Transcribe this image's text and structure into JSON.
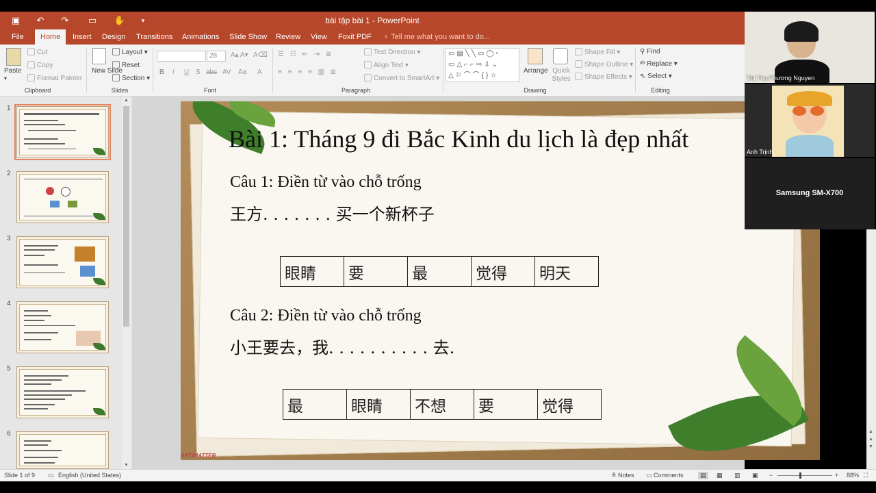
{
  "window": {
    "title": "bài tập bài 1 - PowerPoint"
  },
  "quick_access": {
    "save_icon": "save-icon",
    "undo_icon": "undo-icon",
    "redo_icon": "redo-icon",
    "present_icon": "present-icon",
    "touch_icon": "touch-mode-icon",
    "customize_icon": "customize-icon"
  },
  "tabs": [
    {
      "label": "File"
    },
    {
      "label": "Home"
    },
    {
      "label": "Insert"
    },
    {
      "label": "Design"
    },
    {
      "label": "Transitions"
    },
    {
      "label": "Animations"
    },
    {
      "label": "Slide Show"
    },
    {
      "label": "Review"
    },
    {
      "label": "View"
    },
    {
      "label": "Foxit PDF"
    },
    {
      "label": "Tell me what you want to do..."
    }
  ],
  "ribbon": {
    "clipboard": {
      "paste": "Paste",
      "cut": "Cut",
      "copy": "Copy",
      "format_painter": "Format Painter",
      "label": "Clipboard"
    },
    "slides": {
      "new_slide": "New Slide",
      "layout": "Layout",
      "reset": "Reset",
      "section": "Section",
      "label": "Slides"
    },
    "font": {
      "font_size": "28",
      "label": "Font",
      "buttons": [
        "B",
        "I",
        "U",
        "S",
        "abc",
        "AV",
        "Aa",
        "A"
      ]
    },
    "paragraph": {
      "text_direction": "Text Direction",
      "align_text": "Align Text",
      "convert_smartart": "Convert to SmartArt",
      "label": "Paragraph"
    },
    "drawing": {
      "arrange": "Arrange",
      "quick_styles": "Quick Styles",
      "shape_fill": "Shape Fill",
      "shape_outline": "Shape Outline",
      "shape_effects": "Shape Effects",
      "label": "Drawing"
    },
    "editing": {
      "find": "Find",
      "replace": "Replace",
      "select": "Select",
      "label": "Editing"
    }
  },
  "thumbnails": [
    {
      "num": "1"
    },
    {
      "num": "2"
    },
    {
      "num": "3"
    },
    {
      "num": "4"
    },
    {
      "num": "5"
    },
    {
      "num": "6"
    }
  ],
  "slide": {
    "title": "Bài 1: Tháng 9 đi Bắc Kinh du lịch là đẹp nhất",
    "q1_label": "Câu 1: Điền từ vào chỗ trống",
    "q1_sentence": "王方. . . . . . .   买一个新杯子",
    "q1_words": [
      "眼睛",
      "要",
      "最",
      "觉得",
      "明天"
    ],
    "q2_label": "Câu 2: Điền từ vào chỗ trống",
    "q2_sentence": "小王要去，我. . . . . . . . . .   去.",
    "q2_words": [
      "最",
      "眼睛",
      "不想",
      "要",
      "觉得"
    ],
    "brand": "ANTIMATTER"
  },
  "video": {
    "participant1": "Thị Thu Phương Nguyen",
    "participant2": "Anh Trịnh",
    "device": "Samsung SM-X700"
  },
  "status": {
    "slide_info": "Slide 1 of 9",
    "language": "English (United States)",
    "notes": "Notes",
    "comments": "Comments",
    "zoom": "88%"
  }
}
